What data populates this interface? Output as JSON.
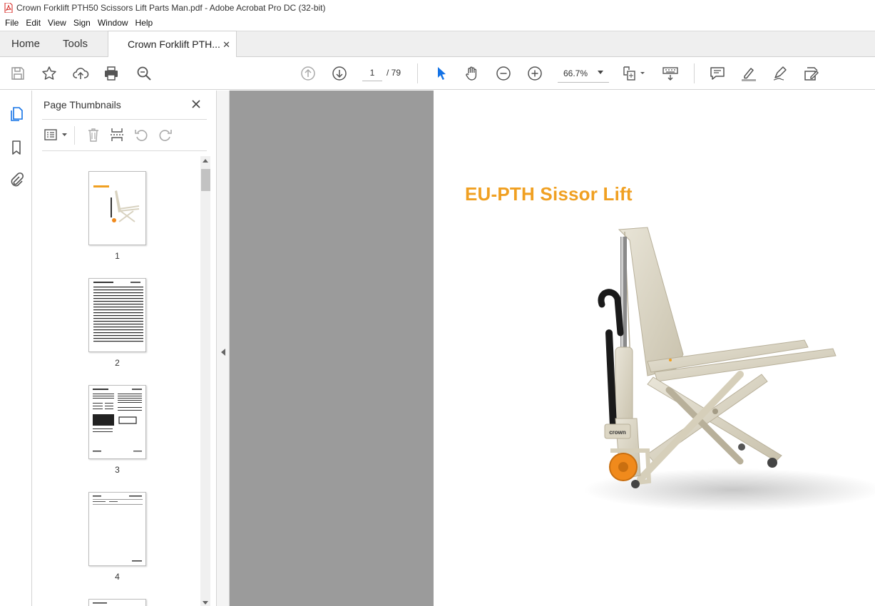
{
  "window": {
    "title": "Crown Forklift PTH50 Scissors Lift Parts Man.pdf - Adobe Acrobat Pro DC (32-bit)"
  },
  "menu": {
    "items": [
      "File",
      "Edit",
      "View",
      "Sign",
      "Window",
      "Help"
    ]
  },
  "tabs": {
    "home": "Home",
    "tools": "Tools",
    "document": "Crown Forklift PTH..."
  },
  "toolbar": {
    "current_page": "1",
    "total_pages": "/ 79",
    "zoom": "66.7%"
  },
  "icons": {
    "save": "save-icon",
    "bookmark_star": "star-icon",
    "upload": "cloud-upload-icon",
    "print": "print-icon",
    "find": "search-icon",
    "prev_page": "arrow-up-circle-icon",
    "next_page": "arrow-down-circle-icon",
    "select": "pointer-icon",
    "hand": "hand-icon",
    "zoom_out": "zoom-out-icon",
    "zoom_in": "zoom-in-icon",
    "fit": "page-fit-icon",
    "keyboard": "keyboard-scroll-icon",
    "comment": "comment-icon",
    "highlight": "highlight-icon",
    "draw": "pen-icon",
    "fill_sign": "fill-sign-icon"
  },
  "colors": {
    "accent_blue": "#1473e6",
    "heading_orange": "#f0a022",
    "canvas_gray": "#9b9b9b"
  },
  "thumbnails_panel": {
    "title": "Page Thumbnails",
    "pages": [
      {
        "label": "1"
      },
      {
        "label": "2"
      },
      {
        "label": "3"
      },
      {
        "label": "4"
      }
    ]
  },
  "document": {
    "heading": "EU-PTH Sissor Lift",
    "logo_text": "crown"
  }
}
